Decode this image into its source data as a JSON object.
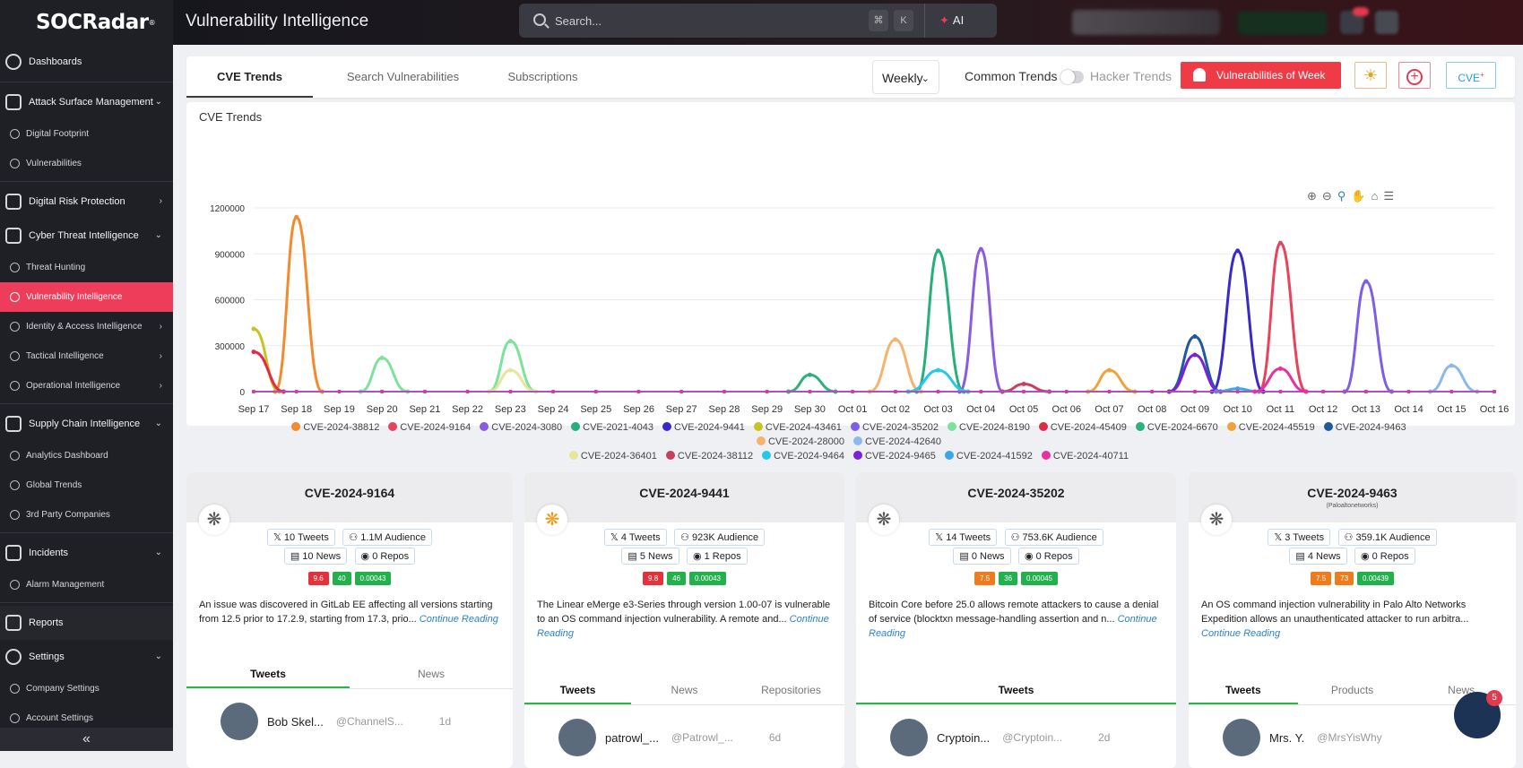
{
  "brand": {
    "logo_text": "SOCRadar",
    "logo_reg": "®"
  },
  "header": {
    "page_title": "Vulnerability Intelligence",
    "search_placeholder": "Search...",
    "kbd_cmd": "⌘",
    "kbd_k": "K",
    "ai_label": "AI"
  },
  "sidebar": {
    "dashboards": "Dashboards",
    "asm": "Attack Surface Management",
    "digital_footprint": "Digital Footprint",
    "vulnerabilities": "Vulnerabilities",
    "drp": "Digital Risk Protection",
    "cti": "Cyber Threat Intelligence",
    "threat_hunting": "Threat Hunting",
    "vuln_intel": "Vulnerability Intelligence",
    "iam_intel": "Identity & Access Intelligence",
    "tactical": "Tactical Intelligence",
    "operational": "Operational Intelligence",
    "supply_chain": "Supply Chain Intelligence",
    "analytics": "Analytics Dashboard",
    "global_trends": "Global Trends",
    "third_party": "3rd Party Companies",
    "incidents": "Incidents",
    "alarm_mgmt": "Alarm Management",
    "reports": "Reports",
    "settings": "Settings",
    "company_settings": "Company Settings",
    "account_settings": "Account Settings"
  },
  "tabs": {
    "cve_trends": "CVE Trends",
    "search_vuln": "Search Vulnerabilities",
    "subscriptions": "Subscriptions"
  },
  "controls": {
    "frequency": "Weekly",
    "common_trends": "Common Trends",
    "hacker_trends": "Hacker Trends",
    "vuln_of_week": "Vulnerabilities of Week",
    "cve_button": "CVE",
    "cve_sup": "+"
  },
  "chart_title": "CVE Trends",
  "chart_data": {
    "type": "line",
    "title": "CVE Trends",
    "x": [
      "Sep 17",
      "Sep 18",
      "Sep 19",
      "Sep 20",
      "Sep 21",
      "Sep 22",
      "Sep 23",
      "Sep 24",
      "Sep 25",
      "Sep 26",
      "Sep 27",
      "Sep 28",
      "Sep 29",
      "Sep 30",
      "Oct 01",
      "Oct 02",
      "Oct 03",
      "Oct 04",
      "Oct 05",
      "Oct 06",
      "Oct 07",
      "Oct 08",
      "Oct 09",
      "Oct 10",
      "Oct 11",
      "Oct 12",
      "Oct 13",
      "Oct 14",
      "Oct 15",
      "Oct 16"
    ],
    "yticks": [
      0,
      300000,
      600000,
      900000,
      1200000
    ],
    "ylim": [
      0,
      1200000
    ],
    "series": [
      {
        "name": "CVE-2024-38812",
        "color": "#f28a2e",
        "points": [
          [
            0.5,
            0
          ],
          [
            1,
            1140000
          ],
          [
            1.6,
            0
          ]
        ]
      },
      {
        "name": "CVE-2024-9164",
        "color": "#e8435a",
        "points": [
          [
            23.5,
            0
          ],
          [
            24,
            970000
          ],
          [
            24.6,
            0
          ]
        ]
      },
      {
        "name": "CVE-2024-3080",
        "color": "#8b5cdf",
        "points": [
          [
            16.5,
            0
          ],
          [
            17,
            930000
          ],
          [
            17.5,
            0
          ]
        ]
      },
      {
        "name": "CVE-2021-4043",
        "color": "#27ae7a",
        "points": [
          [
            15.5,
            0
          ],
          [
            16,
            920000
          ],
          [
            16.6,
            0
          ]
        ]
      },
      {
        "name": "CVE-2024-9441",
        "color": "#3a29c8",
        "points": [
          [
            22.4,
            0
          ],
          [
            23,
            920000
          ],
          [
            23.6,
            0
          ]
        ]
      },
      {
        "name": "CVE-2024-43461",
        "color": "#c8c320",
        "points": [
          [
            0,
            410000
          ],
          [
            0.6,
            0
          ]
        ]
      },
      {
        "name": "CVE-2024-35202",
        "color": "#7c5ee8",
        "points": [
          [
            25.5,
            0
          ],
          [
            26,
            720000
          ],
          [
            26.6,
            0
          ]
        ]
      },
      {
        "name": "CVE-2024-8190",
        "color": "#7de39a",
        "points": [
          [
            5.5,
            0
          ],
          [
            6,
            330000
          ],
          [
            6.6,
            0
          ],
          [
            2.5,
            0
          ],
          [
            3,
            220000
          ],
          [
            3.6,
            0
          ]
        ]
      },
      {
        "name": "CVE-2024-45409",
        "color": "#e02b48",
        "points": [
          [
            0,
            260000
          ],
          [
            0.7,
            0
          ]
        ]
      },
      {
        "name": "CVE-2024-6670",
        "color": "#2fb07a",
        "points": [
          [
            12.5,
            0
          ],
          [
            13,
            110000
          ],
          [
            13.6,
            0
          ]
        ]
      },
      {
        "name": "CVE-2024-45519",
        "color": "#f2a23a",
        "points": [
          [
            19.5,
            0
          ],
          [
            20,
            140000
          ],
          [
            20.6,
            0
          ]
        ]
      },
      {
        "name": "CVE-2024-9463",
        "color": "#1e5a9c",
        "points": [
          [
            21.4,
            0
          ],
          [
            22,
            360000
          ],
          [
            22.6,
            0
          ]
        ]
      },
      {
        "name": "CVE-2024-28000",
        "color": "#f5b46e",
        "points": [
          [
            14.4,
            0
          ],
          [
            15,
            340000
          ],
          [
            15.6,
            0
          ]
        ]
      },
      {
        "name": "CVE-2024-42640",
        "color": "#8db8ea",
        "points": [
          [
            27.5,
            0
          ],
          [
            28,
            170000
          ],
          [
            28.6,
            0
          ]
        ]
      },
      {
        "name": "CVE-2024-36401",
        "color": "#e5e69c",
        "points": [
          [
            5.5,
            0
          ],
          [
            6,
            140000
          ],
          [
            6.6,
            0
          ]
        ]
      },
      {
        "name": "CVE-2024-38112",
        "color": "#c7405e",
        "points": [
          [
            17.5,
            0
          ],
          [
            18,
            50000
          ],
          [
            18.6,
            0
          ]
        ]
      },
      {
        "name": "CVE-2024-9464",
        "color": "#27c7e8",
        "points": [
          [
            15.3,
            0
          ],
          [
            16,
            140000
          ],
          [
            16.7,
            0
          ]
        ]
      },
      {
        "name": "CVE-2024-9465",
        "color": "#7a22d8",
        "points": [
          [
            21.4,
            0
          ],
          [
            22,
            240000
          ],
          [
            22.6,
            0
          ]
        ]
      },
      {
        "name": "CVE-2024-41592",
        "color": "#3aa6e8",
        "points": [
          [
            22.5,
            0
          ],
          [
            23,
            20000
          ],
          [
            23.5,
            0
          ]
        ]
      },
      {
        "name": "CVE-2024-40711",
        "color": "#ec2fa0",
        "points": [
          [
            23.4,
            0
          ],
          [
            24,
            150000
          ],
          [
            24.6,
            0
          ]
        ]
      }
    ]
  },
  "cards": [
    {
      "cve": "CVE-2024-9164",
      "vendor": "",
      "spider_color": "#555",
      "tweets": "10 Tweets",
      "audience": "1.1M Audience",
      "news": "10 News",
      "repos": "0 Repos",
      "scores": [
        [
          "9.6",
          "s-red"
        ],
        [
          "40",
          "s-grn"
        ],
        [
          "0.00043",
          "s-grn"
        ]
      ],
      "desc": "An issue was discovered in GitLab EE affecting all versions starting from 12.5 prior to 17.2.9, starting from 17.3, prio...",
      "more": "Continue Reading",
      "tabs": [
        "Tweets",
        "News"
      ],
      "tweet": {
        "name": "Bob Skel...",
        "handle": "@ChannelS...",
        "time": "1d"
      }
    },
    {
      "cve": "CVE-2024-9441",
      "vendor": "",
      "spider_color": "#f29a17",
      "tweets": "4 Tweets",
      "audience": "923K Audience",
      "news": "5 News",
      "repos": "1 Repos",
      "scores": [
        [
          "9.8",
          "s-red"
        ],
        [
          "46",
          "s-grn"
        ],
        [
          "0.00043",
          "s-grn"
        ]
      ],
      "desc": "The Linear eMerge e3-Series through version 1.00-07 is vulnerable to an OS command injection vulnerability. A remote and...",
      "more": "Continue Reading",
      "tabs": [
        "Tweets",
        "News",
        "Repositories"
      ],
      "tweet": {
        "name": "patrowl_...",
        "handle": "@Patrowl_...",
        "time": "6d"
      }
    },
    {
      "cve": "CVE-2024-35202",
      "vendor": "",
      "spider_color": "#555",
      "tweets": "14 Tweets",
      "audience": "753.6K Audience",
      "news": "0 News",
      "repos": "0 Repos",
      "scores": [
        [
          "7.5",
          "s-org"
        ],
        [
          "36",
          "s-grn"
        ],
        [
          "0.00045",
          "s-grn"
        ]
      ],
      "desc": "Bitcoin Core before 25.0 allows remote attackers to cause a denial of service (blocktxn message-handling assertion and n...",
      "more": "Continue Reading",
      "tabs": [
        "Tweets"
      ],
      "tweet": {
        "name": "Cryptoin...",
        "handle": "@Cryptoin...",
        "time": "2d"
      }
    },
    {
      "cve": "CVE-2024-9463",
      "vendor": "(Paloaltonetworks)",
      "spider_color": "#555",
      "tweets": "3 Tweets",
      "audience": "359.1K Audience",
      "news": "4 News",
      "repos": "0 Repos",
      "scores": [
        [
          "7.5",
          "s-org"
        ],
        [
          "73",
          "s-org"
        ],
        [
          "0.00439",
          "s-grn"
        ]
      ],
      "desc": "An OS command injection vulnerability in Palo Alto Networks Expedition allows an unauthenticated attacker to run arbitra...",
      "more": "Continue Reading",
      "tabs": [
        "Tweets",
        "Products",
        "News"
      ],
      "tweet": {
        "name": "Mrs. Y.",
        "handle": "@MrsYisWhy",
        "time": ""
      }
    }
  ],
  "chat_badge": "5"
}
